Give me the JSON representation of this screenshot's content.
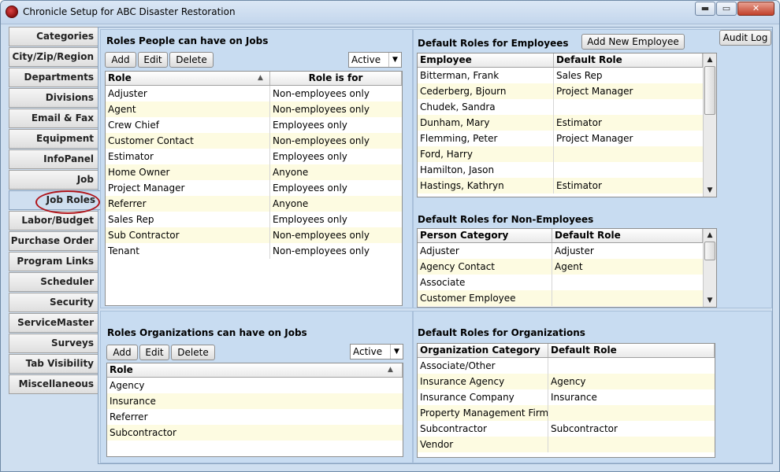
{
  "window": {
    "title": "Chronicle Setup for ABC Disaster Restoration",
    "min": "▬",
    "max": "▭",
    "close": "✕"
  },
  "tabs": [
    "Categories",
    "City/Zip/Region",
    "Departments",
    "Divisions",
    "Email & Fax",
    "Equipment",
    "InfoPanel",
    "Job",
    "Job Roles",
    "Labor/Budget",
    "Purchase Order",
    "Program Links",
    "Scheduler",
    "Security",
    "ServiceMaster",
    "Surveys",
    "Tab Visibility",
    "Miscellaneous"
  ],
  "active_tab": "Job Roles",
  "people_roles": {
    "title": "Roles People can have on Jobs",
    "buttons": {
      "add": "Add",
      "edit": "Edit",
      "delete": "Delete"
    },
    "filter": "Active",
    "columns": [
      "Role",
      "Role is for"
    ],
    "rows": [
      [
        "Adjuster",
        "Non-employees only"
      ],
      [
        "Agent",
        "Non-employees only"
      ],
      [
        "Crew Chief",
        "Employees only"
      ],
      [
        "Customer Contact",
        "Non-employees only"
      ],
      [
        "Estimator",
        "Employees only"
      ],
      [
        "Home Owner",
        "Anyone"
      ],
      [
        "Project Manager",
        "Employees only"
      ],
      [
        "Referrer",
        "Anyone"
      ],
      [
        "Sales Rep",
        "Employees only"
      ],
      [
        "Sub Contractor",
        "Non-employees only"
      ],
      [
        "Tenant",
        "Non-employees only"
      ]
    ]
  },
  "employee_roles": {
    "title": "Default Roles for Employees",
    "add_button": "Add New Employee",
    "audit_button": "Audit Log",
    "columns": [
      "Employee",
      "Default Role"
    ],
    "rows": [
      [
        "Bitterman, Frank",
        "Sales Rep"
      ],
      [
        "Cederberg, Bjourn",
        "Project Manager"
      ],
      [
        "Chudek, Sandra",
        ""
      ],
      [
        "Dunham, Mary",
        "Estimator"
      ],
      [
        "Flemming, Peter",
        "Project Manager"
      ],
      [
        "Ford, Harry",
        ""
      ],
      [
        "Hamilton, Jason",
        ""
      ],
      [
        "Hastings, Kathryn",
        "Estimator"
      ]
    ]
  },
  "nonemployee_roles": {
    "title": "Default Roles for Non-Employees",
    "columns": [
      "Person Category",
      "Default Role"
    ],
    "rows": [
      [
        "Adjuster",
        "Adjuster"
      ],
      [
        "Agency Contact",
        "Agent"
      ],
      [
        "Associate",
        ""
      ],
      [
        "Customer Employee",
        ""
      ]
    ]
  },
  "org_roles": {
    "title": "Roles Organizations can have on Jobs",
    "buttons": {
      "add": "Add",
      "edit": "Edit",
      "delete": "Delete"
    },
    "filter": "Active",
    "columns": [
      "Role"
    ],
    "rows": [
      [
        "Agency"
      ],
      [
        "Insurance"
      ],
      [
        "Referrer"
      ],
      [
        "Subcontractor"
      ]
    ]
  },
  "org_default_roles": {
    "title": "Default Roles for Organizations",
    "columns": [
      "Organization Category",
      "Default Role"
    ],
    "rows": [
      [
        "Associate/Other",
        ""
      ],
      [
        "Insurance Agency",
        "Agency"
      ],
      [
        "Insurance Company",
        "Insurance"
      ],
      [
        "Property Management Firm",
        ""
      ],
      [
        "Subcontractor",
        "Subcontractor"
      ],
      [
        "Vendor",
        ""
      ]
    ]
  },
  "colors": {
    "panel": "#c8dcf1",
    "row_alt": "#fdfbe1",
    "highlight": "#b0141a"
  }
}
